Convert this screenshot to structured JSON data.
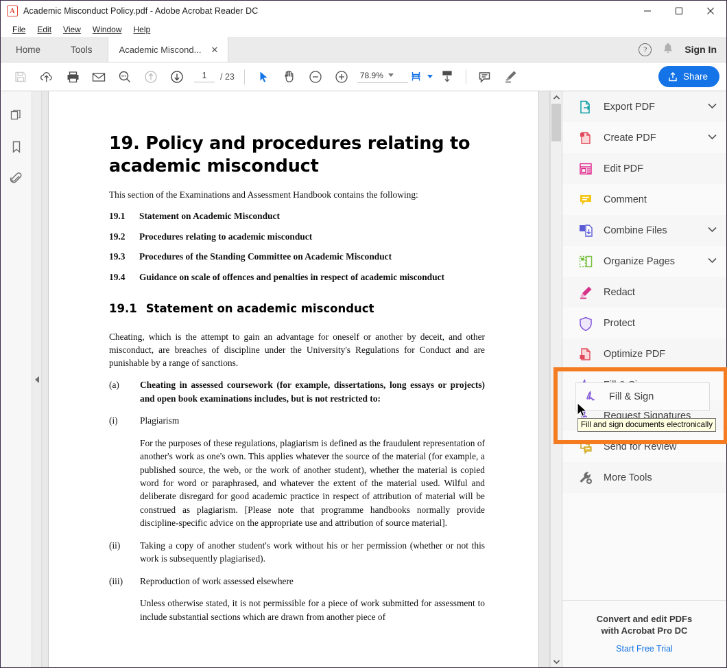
{
  "window": {
    "title": "Academic Misconduct Policy.pdf - Adobe Acrobat Reader DC",
    "app_icon": "pdf-file-icon",
    "minimize": "—",
    "maximize": "☐",
    "close": "✕"
  },
  "menu": [
    {
      "label": "File",
      "accel": "F"
    },
    {
      "label": "Edit",
      "accel": "E"
    },
    {
      "label": "View",
      "accel": "V"
    },
    {
      "label": "Window",
      "accel": "W"
    },
    {
      "label": "Help",
      "accel": "H"
    }
  ],
  "tabs": {
    "home": "Home",
    "tools": "Tools",
    "document": "Academic Miscond...",
    "close_glyph": "✕",
    "help_glyph": "?",
    "bell_glyph": "🔔",
    "sign_in": "Sign In"
  },
  "toolbar": {
    "save": "save-icon",
    "upload_cloud": "upload-to-cloud-icon",
    "print": "print-icon",
    "email": "email-icon",
    "find": "find-icon",
    "prev_page": "previous-page-icon",
    "next_page": "next-page-icon",
    "page_current": "1",
    "page_separator": "/",
    "page_total": "23",
    "select_tool": "select-cursor-icon",
    "hand_tool": "hand-icon",
    "zoom_out": "zoom-out-icon",
    "zoom_in": "zoom-in-icon",
    "zoom_value": "78.9%",
    "fit_page": "fit-page-icon",
    "scroll_mode": "page-display-icon",
    "comment": "comment-icon",
    "highlight": "highlight-pen-icon",
    "share_label": "Share"
  },
  "left_rail": [
    {
      "name": "page-thumbnails-icon",
      "label": "Page Thumbnails"
    },
    {
      "name": "bookmarks-icon",
      "label": "Bookmarks"
    },
    {
      "name": "attachments-icon",
      "label": "Attachments"
    }
  ],
  "tools_pane": {
    "items": [
      {
        "label": "Export PDF",
        "icon": "export-pdf-icon",
        "chevron": "⌄",
        "has_chevron": true
      },
      {
        "label": "Create PDF",
        "icon": "create-pdf-icon",
        "chevron": "⌄",
        "has_chevron": true
      },
      {
        "label": "Edit PDF",
        "icon": "edit-pdf-icon",
        "has_chevron": false
      },
      {
        "label": "Comment",
        "icon": "comment-icon",
        "has_chevron": false
      },
      {
        "label": "Combine Files",
        "icon": "combine-files-icon",
        "chevron": "⌄",
        "has_chevron": true
      },
      {
        "label": "Organize Pages",
        "icon": "organize-pages-icon",
        "chevron": "⌄",
        "has_chevron": true
      },
      {
        "label": "Redact",
        "icon": "redact-icon",
        "has_chevron": false
      },
      {
        "label": "Protect",
        "icon": "protect-shield-icon",
        "has_chevron": false
      },
      {
        "label": "Optimize PDF",
        "icon": "optimize-pdf-icon",
        "has_chevron": false
      },
      {
        "label": "Fill & Sign",
        "icon": "fill-and-sign-icon",
        "has_chevron": false
      },
      {
        "label": "Request Signatures",
        "icon": "request-signatures-icon",
        "has_chevron": false
      },
      {
        "label": "Send for Review",
        "icon": "send-for-review-icon",
        "has_chevron": false
      },
      {
        "label": "More Tools",
        "icon": "more-tools-icon",
        "has_chevron": false
      }
    ],
    "promo_line1": "Convert and edit PDFs",
    "promo_line2": "with Acrobat Pro DC",
    "promo_link": "Start Free Trial"
  },
  "highlight": {
    "target_label": "Fill & Sign",
    "tooltip": "Fill and sign documents electronically",
    "color": "#f47b20"
  },
  "document": {
    "heading": "19. Policy and procedures relating to academic misconduct",
    "intro": "This section of the Examinations and Assessment Handbook contains the following:",
    "toc": [
      {
        "num": "19.1",
        "text": "Statement on Academic Misconduct"
      },
      {
        "num": "19.2",
        "text": "Procedures relating to academic misconduct"
      },
      {
        "num": "19.3",
        "text": "Procedures of the Standing Committee on Academic Misconduct"
      },
      {
        "num": "19.4",
        "text": "Guidance on scale of offences and penalties in respect of academic misconduct"
      }
    ],
    "section_num": "19.1",
    "section_title": "Statement on academic misconduct",
    "para1": "Cheating, which is the attempt to gain an advantage for oneself or another by deceit, and other misconduct, are breaches of discipline under the University's Regulations for Conduct and are punishable by a range of sanctions.",
    "item_a_label": "(a)",
    "item_a_text": "Cheating in assessed coursework (for example, dissertations, long essays or projects) and open book examinations includes, but is not restricted to:",
    "item_i_label": "(i)",
    "item_i_text": "Plagiarism",
    "item_i_body": "For the purposes of these regulations, plagiarism is defined as the fraudulent representation of another's work as one's own. This applies whatever the source of the material (for example, a published source, the web, or the work of another student), whether the material is copied word for word or paraphrased, and whatever the extent of the material used. Wilful and deliberate disregard for good academic practice in respect of attribution of material will be construed as plagiarism. [Please note that programme handbooks normally provide discipline-specific advice on the appropriate use and attribution of source material].",
    "item_ii_label": "(ii)",
    "item_ii_text": "Taking a copy of another student's work without his or her permission (whether or not this work is subsequently plagiarised).",
    "item_iii_label": "(iii)",
    "item_iii_text": "Reproduction of work assessed elsewhere",
    "item_iii_body": "Unless otherwise stated, it is not permissible for a piece of work submitted for assessment to include substantial sections which are drawn from another piece of"
  }
}
